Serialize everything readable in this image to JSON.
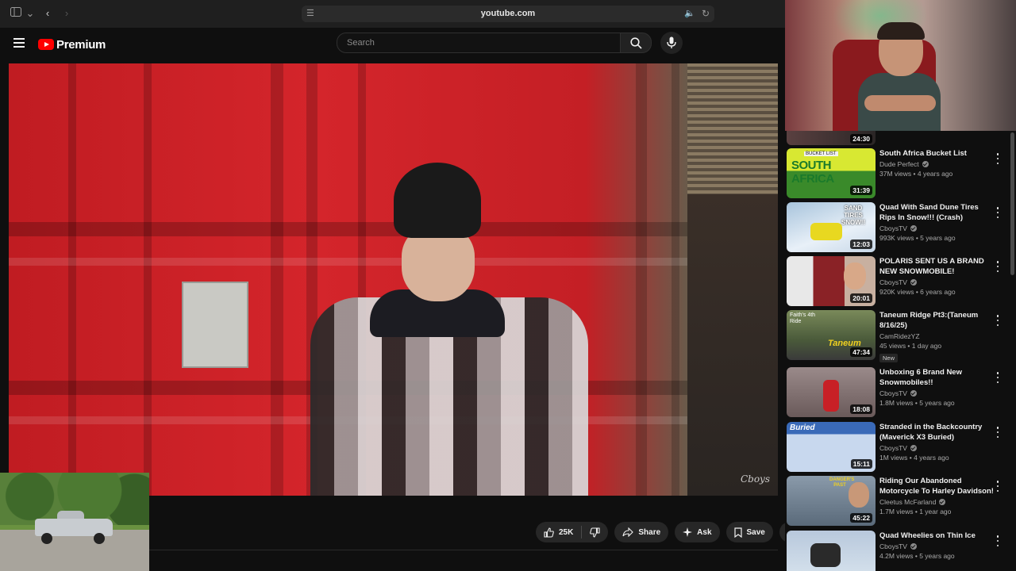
{
  "browser": {
    "url": "youtube.com"
  },
  "header": {
    "logo_text": "Premium",
    "search_placeholder": "Search"
  },
  "video": {
    "watermark": "Cboys"
  },
  "actions": {
    "likes": "25K",
    "share": "Share",
    "ask": "Ask",
    "save": "Save"
  },
  "sidebar": {
    "partial_duration": "24:30",
    "items": [
      {
        "title": "South Africa Bucket List",
        "channel": "Dude Perfect",
        "verified": true,
        "stats": "37M views • 4 years ago",
        "duration": "31:39",
        "thumb_color": "#3a8a2a"
      },
      {
        "title": "Quad With Sand Dune Tires Rips In Snow!!! (Crash)",
        "channel": "CboysTV",
        "verified": true,
        "stats": "993K views • 5 years ago",
        "duration": "12:03",
        "thumb_color": "#a8c4dc"
      },
      {
        "title": "POLARIS SENT US A BRAND NEW SNOWMOBILE!",
        "channel": "CboysTV",
        "verified": true,
        "stats": "920K views • 6 years ago",
        "duration": "20:01",
        "thumb_color": "#8a2226"
      },
      {
        "title": "Taneum Ridge Pt3:(Taneum 8/16/25)",
        "channel": "CamRidezYZ",
        "verified": false,
        "stats": "45 views • 1 day ago",
        "badge": "New",
        "duration": "47:34",
        "thumb_color": "#5a6a3a"
      },
      {
        "title": "Unboxing 6 Brand New Snowmobiles!!",
        "channel": "CboysTV",
        "verified": true,
        "stats": "1.8M views • 5 years ago",
        "duration": "18:08",
        "thumb_color": "#7a6a6a"
      },
      {
        "title": "Stranded in the Backcountry (Maverick X3 Buried)",
        "channel": "CboysTV",
        "verified": true,
        "stats": "1M views • 4 years ago",
        "duration": "15:11",
        "thumb_color": "#c8d8ee"
      },
      {
        "title": "Riding Our Abandoned Motorcycle To Harley Davidson!",
        "channel": "Cleetus McFarland",
        "verified": true,
        "stats": "1.7M views • 1 year ago",
        "duration": "45:22",
        "thumb_color": "#6a7a8a"
      },
      {
        "title": "Quad Wheelies on Thin Ice",
        "channel": "CboysTV",
        "verified": true,
        "stats": "4.2M views • 5 years ago",
        "duration": "",
        "thumb_color": "#b8c8dc"
      }
    ]
  },
  "thumb_text": {
    "item0_overlay": "SOUTH AFRICA",
    "item0_tag": "BUCKET LIST",
    "item1_overlay": "SAND TIRES SNOW!!",
    "item3_overlay": "Taneum",
    "item3_corner": "Faith's 4th Ride",
    "item5_overlay": "Buried",
    "item6_overlay": "DANGER'S PAST"
  }
}
